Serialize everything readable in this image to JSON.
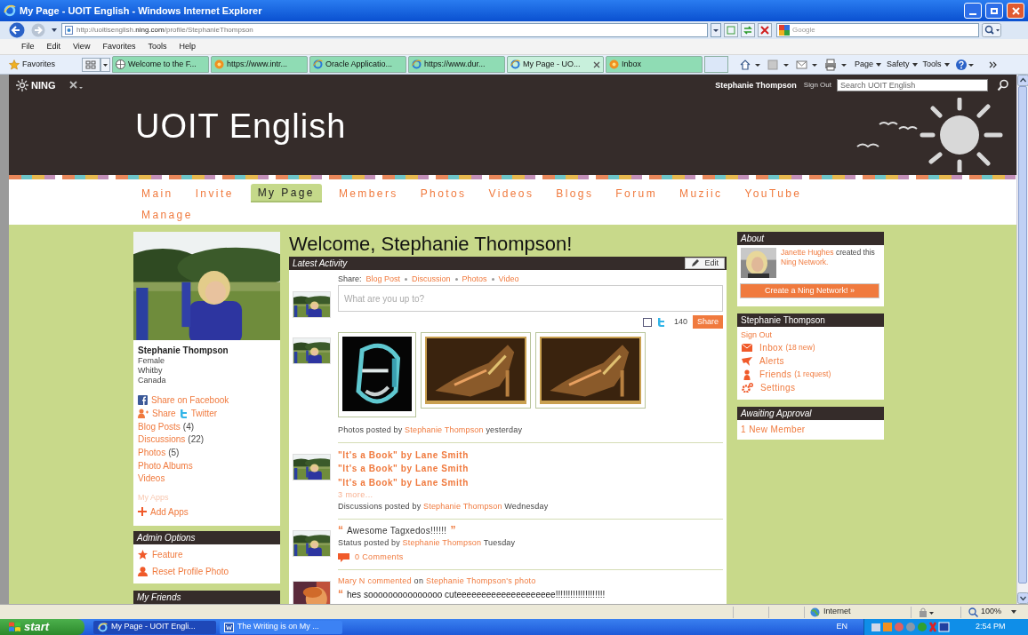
{
  "window": {
    "title": "My Page - UOIT English - Windows Internet Explorer"
  },
  "address_bar": {
    "url_start": "http://uoitisenglish.",
    "url_domain": "ning.com",
    "url_end": "/profile/StephanieThompson",
    "search_placeholder": "Google"
  },
  "menu_bar": [
    "File",
    "Edit",
    "View",
    "Favorites",
    "Tools",
    "Help"
  ],
  "favorites_bar": {
    "label": "Favorites",
    "tabs": [
      {
        "label": "Welcome to the F...",
        "selected": false,
        "kind": "globe"
      },
      {
        "label": "https://www.intr...",
        "selected": false,
        "kind": "site"
      },
      {
        "label": "Oracle Applicatio...",
        "selected": false,
        "kind": "ie"
      },
      {
        "label": "https://www.dur...",
        "selected": false,
        "kind": "ie"
      },
      {
        "label": "My Page - UO...",
        "selected": true,
        "kind": "ie"
      },
      {
        "label": "Inbox",
        "selected": false,
        "kind": "site"
      }
    ],
    "commands": [
      "Page",
      "Safety",
      "Tools"
    ]
  },
  "site": {
    "network": "NING",
    "user": "Stephanie Thompson",
    "sign_out": "Sign Out",
    "search_placeholder": "Search UOIT English",
    "title": "UOIT English",
    "nav": [
      {
        "label": "Main",
        "selected": false
      },
      {
        "label": "Invite",
        "selected": false
      },
      {
        "label": "My Page",
        "selected": true
      },
      {
        "label": "Members",
        "selected": false
      },
      {
        "label": "Photos",
        "selected": false
      },
      {
        "label": "Videos",
        "selected": false
      },
      {
        "label": "Blogs",
        "selected": false
      },
      {
        "label": "Forum",
        "selected": false
      },
      {
        "label": "Muziic",
        "selected": false
      },
      {
        "label": "YouTube",
        "selected": false
      },
      {
        "label": "Manage",
        "selected": false
      }
    ]
  },
  "profile": {
    "name": "Stephanie Thompson",
    "details": [
      "Female",
      "Whitby",
      "Canada"
    ],
    "share_facebook": "Share on Facebook",
    "share": "Share",
    "twitter": "Twitter",
    "links": [
      {
        "label": "Blog Posts",
        "count": "(4)"
      },
      {
        "label": "Discussions",
        "count": "(22)"
      },
      {
        "label": "Photos",
        "count": "(5)"
      },
      {
        "label": "Photo Albums"
      },
      {
        "label": "Videos"
      }
    ],
    "apps_heading": "My Apps",
    "add_apps": "Add Apps"
  },
  "admin_options": {
    "title": "Admin Options",
    "items": [
      {
        "kind": "star",
        "label": "Feature"
      },
      {
        "kind": "person",
        "label": "Reset Profile Photo"
      }
    ]
  },
  "my_friends": {
    "title": "My Friends"
  },
  "welcome": "Welcome, Stephanie Thompson!",
  "activity": {
    "title": "Latest Activity",
    "edit": "Edit",
    "composer": {
      "share_label": "Share:",
      "share_links": [
        "Blog Post",
        "Discussion",
        "Photos",
        "Video"
      ],
      "placeholder": "What are you up to?",
      "twitter_checked": false,
      "char_count": "140",
      "share_button": "Share"
    },
    "items": [
      {
        "kind": "photos",
        "prefix": "Photos posted by",
        "author": "Stephanie Thompson",
        "when": "yesterday"
      },
      {
        "kind": "discussions",
        "titles": [
          "\"It's a Book\" by Lane Smith",
          "\"It's a Book\" by Lane Smith",
          "\"It's a Book\" by Lane Smith"
        ],
        "more": "3 more...",
        "prefix": "Discussions posted by",
        "author": "Stephanie Thompson",
        "when": "Wednesday"
      },
      {
        "kind": "status",
        "quote_open": "“",
        "quote": "Awesome Tagxedos!!!!!!",
        "quote_close": "”",
        "prefix": "Status posted by",
        "author": "Stephanie Thompson",
        "when": "Tuesday",
        "comments": "0 Comments"
      },
      {
        "kind": "comment",
        "actor": "Mary N commented",
        "verb": "on",
        "target": "Stephanie Thompson's photo",
        "quote_open": "“",
        "quote": "hes sooooooooooooooo cuteeeeeeeeeeeeeeeeeeee!!!!!!!!!!!!!!!!!!!!"
      }
    ]
  },
  "about": {
    "title": "About",
    "creator": "Janette Hughes",
    "text": "created this",
    "link": "Ning Network.",
    "button": "Create a Ning Network! »"
  },
  "user_box": {
    "title": "Stephanie Thompson",
    "sign_out": "Sign Out",
    "items": [
      {
        "kind": "inbox",
        "label": "Inbox",
        "note": "(18 new)"
      },
      {
        "kind": "alerts",
        "label": "Alerts"
      },
      {
        "kind": "friends",
        "label": "Friends",
        "note": "(1 request)"
      },
      {
        "kind": "settings",
        "label": "Settings"
      }
    ]
  },
  "awaiting": {
    "title": "Awaiting Approval",
    "link": "1 New Member"
  },
  "status_bar": {
    "zone": "Internet",
    "zoom": "100%"
  },
  "taskbar": {
    "start": "start",
    "tasks": [
      {
        "label": "My Page - UOIT Engli...",
        "selected": true,
        "kind": "ie"
      },
      {
        "label": "The Writing is on My ...",
        "selected": false,
        "kind": "word"
      }
    ],
    "language": "EN",
    "clock": "2:54 PM"
  }
}
